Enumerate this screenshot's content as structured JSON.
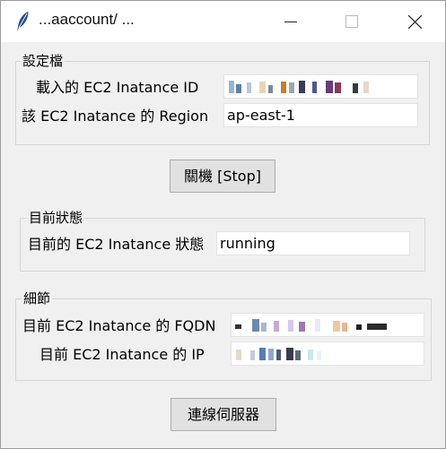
{
  "window": {
    "title": "...aaccount/ ...",
    "icon": "feather-icon"
  },
  "settings": {
    "legend": "設定檔",
    "instance_id_label": "載入的 EC2 Inatance ID",
    "instance_id_value": "",
    "region_label": "該 EC2 Inatance 的 Region",
    "region_value": "ap-east-1"
  },
  "stop_button": {
    "label": "關機 [Stop]"
  },
  "status": {
    "legend": "目前狀態",
    "state_label": "目前的 EC2 Inatance 狀態",
    "state_value": "running"
  },
  "details": {
    "legend": "細節",
    "fqdn_label": "目前 EC2 Inatance 的 FQDN",
    "fqdn_value": "",
    "ip_label": "目前 EC2 Inatance 的 IP",
    "ip_value": ""
  },
  "connect_button": {
    "label": "連線伺服器"
  }
}
